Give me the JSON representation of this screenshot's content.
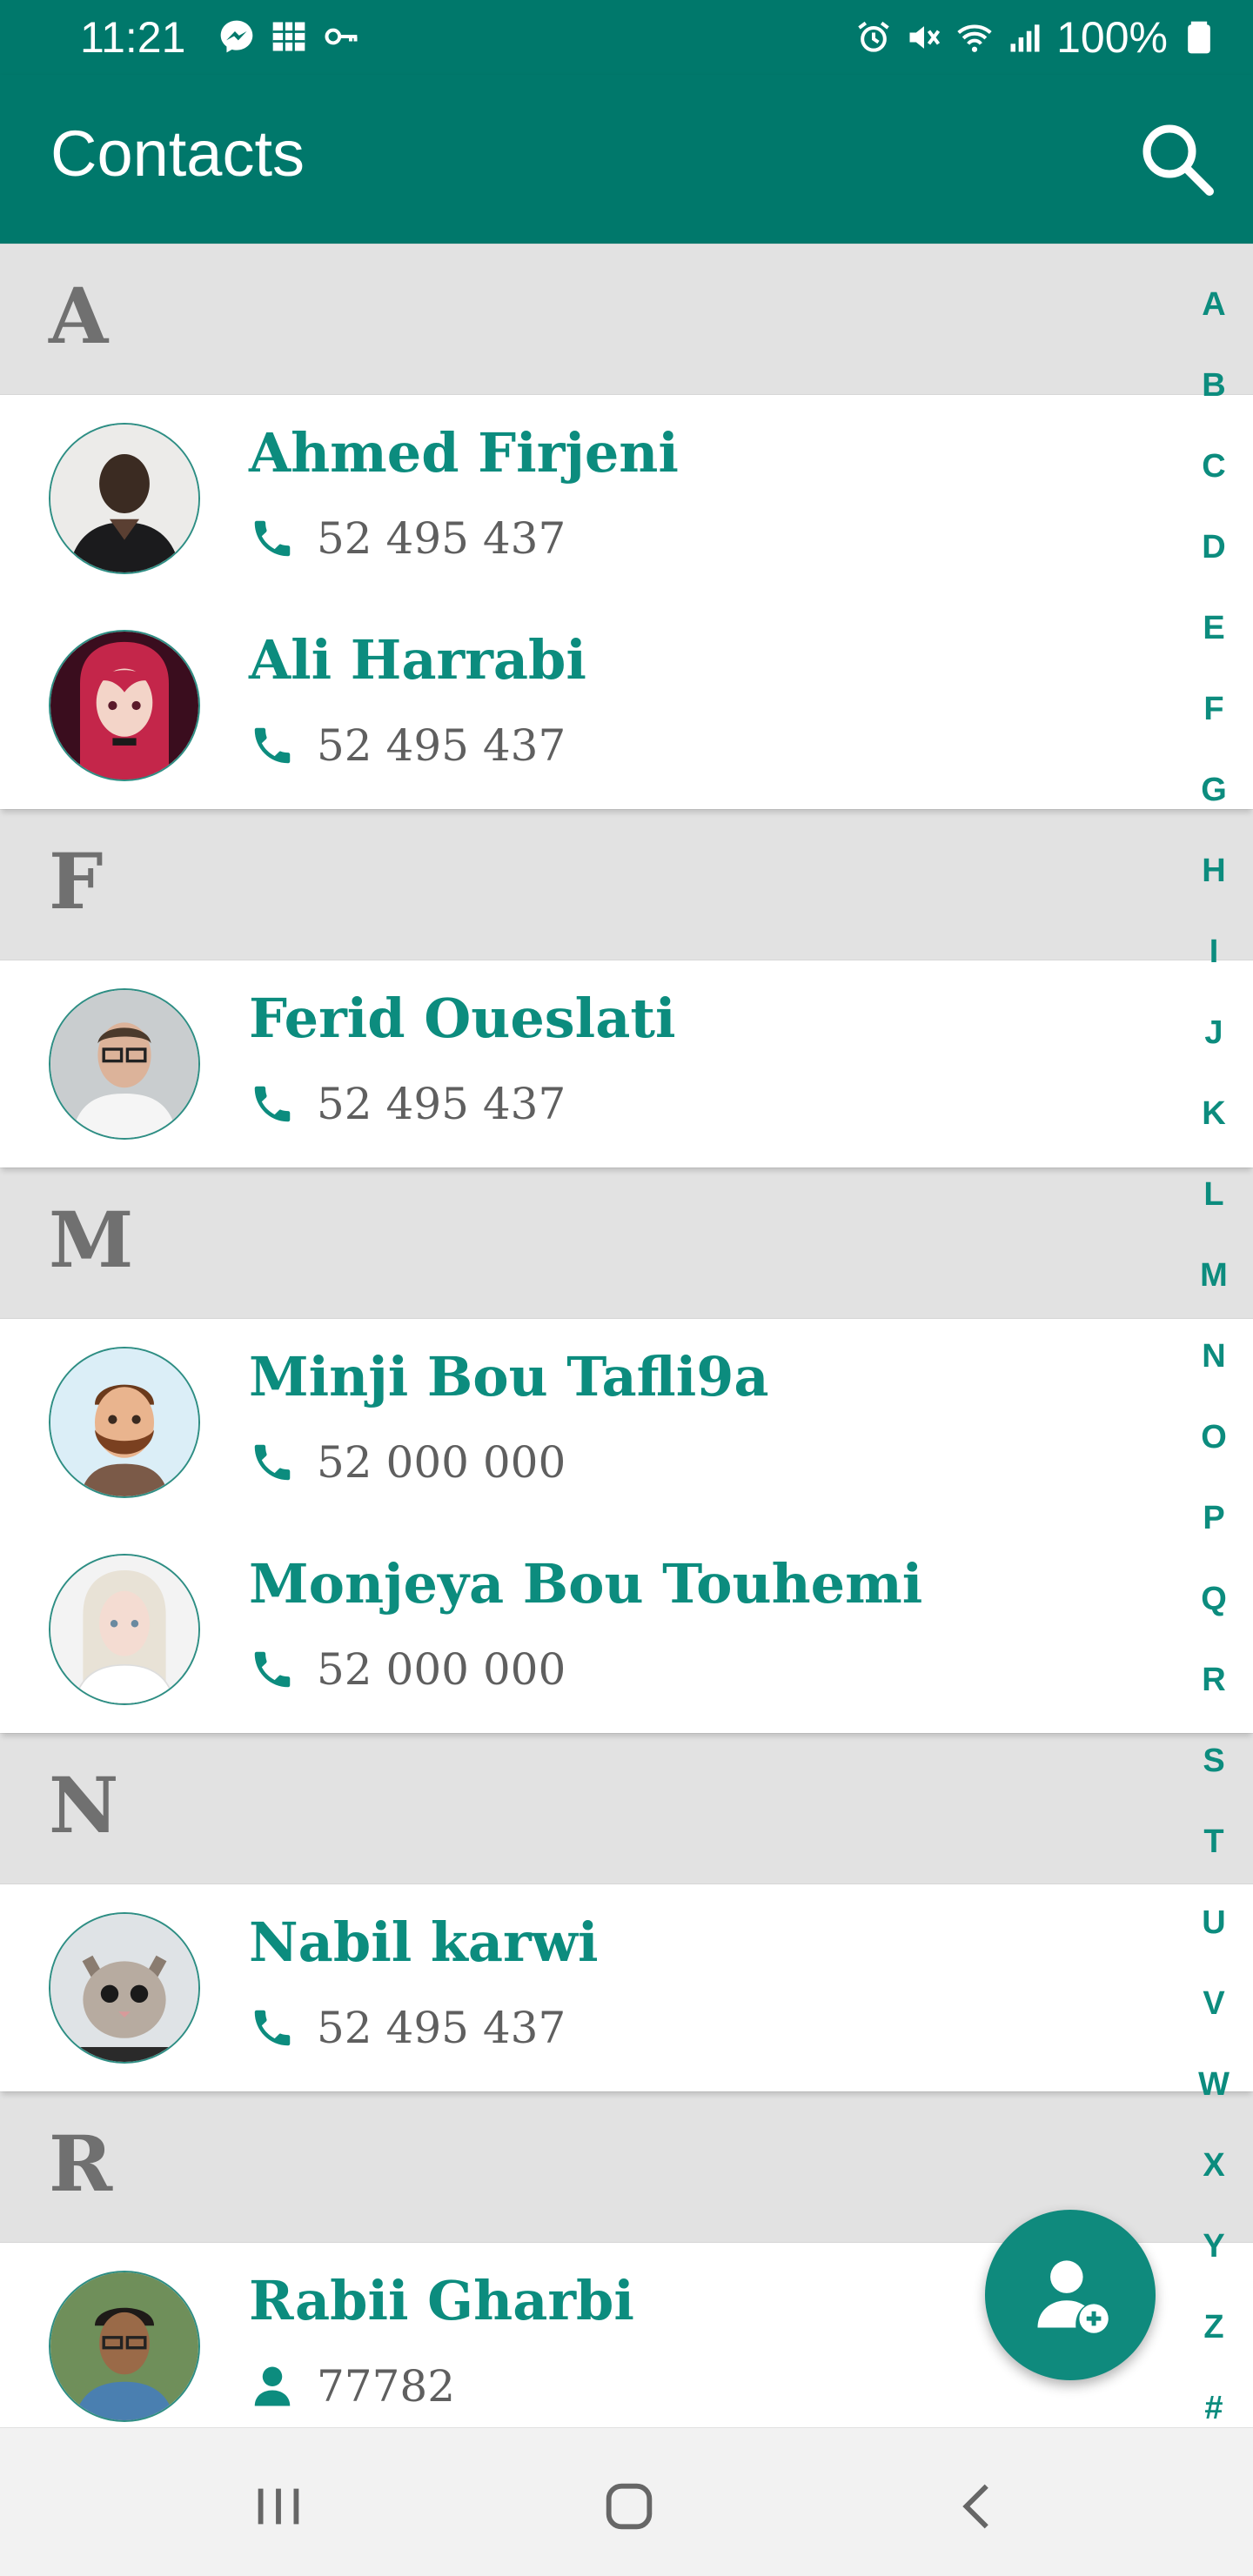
{
  "status_bar": {
    "time": "11:21",
    "battery": "100%",
    "left_icons": [
      "messenger-icon",
      "grid-icon",
      "key-icon"
    ],
    "right_icons": [
      "alarm-icon",
      "mute-icon",
      "wifi-icon",
      "signal-icon",
      "battery-icon"
    ]
  },
  "app_bar": {
    "title": "Contacts",
    "search_icon": "search-icon",
    "color": "#00786b"
  },
  "sections": [
    {
      "letter": "A",
      "contacts": [
        {
          "name": "Ahmed Firjeni",
          "phone": "52 495 437",
          "icon": "phone-icon"
        },
        {
          "name": "Ali Harrabi",
          "phone": "52 495 437",
          "icon": "phone-icon"
        }
      ]
    },
    {
      "letter": "F",
      "contacts": [
        {
          "name": "Ferid Oueslati",
          "phone": "52 495 437",
          "icon": "phone-icon"
        }
      ]
    },
    {
      "letter": "M",
      "contacts": [
        {
          "name": "Minji Bou Tafli9a",
          "phone": "52 000 000",
          "icon": "phone-icon"
        },
        {
          "name": "Monjeya Bou Touhemi",
          "phone": "52 000 000",
          "icon": "phone-icon"
        }
      ]
    },
    {
      "letter": "N",
      "contacts": [
        {
          "name": "Nabil karwi",
          "phone": "52 495 437",
          "icon": "phone-icon"
        }
      ]
    },
    {
      "letter": "R",
      "contacts": [
        {
          "name": "Rabii Gharbi",
          "phone": "77782",
          "icon": "person-icon"
        }
      ]
    }
  ],
  "alphabet_index": [
    "A",
    "B",
    "C",
    "D",
    "E",
    "F",
    "G",
    "H",
    "I",
    "J",
    "K",
    "L",
    "M",
    "N",
    "O",
    "P",
    "Q",
    "R",
    "S",
    "T",
    "U",
    "V",
    "W",
    "X",
    "Y",
    "Z",
    "#"
  ],
  "fab": {
    "icon": "add-contact-icon"
  },
  "nav_bar": {
    "icons": [
      "recent-apps-icon",
      "home-icon",
      "back-icon"
    ]
  },
  "colors": {
    "accent": "#0c8c7e",
    "header_bg": "#e2e2e2",
    "phone_text": "#5f5f5f"
  }
}
